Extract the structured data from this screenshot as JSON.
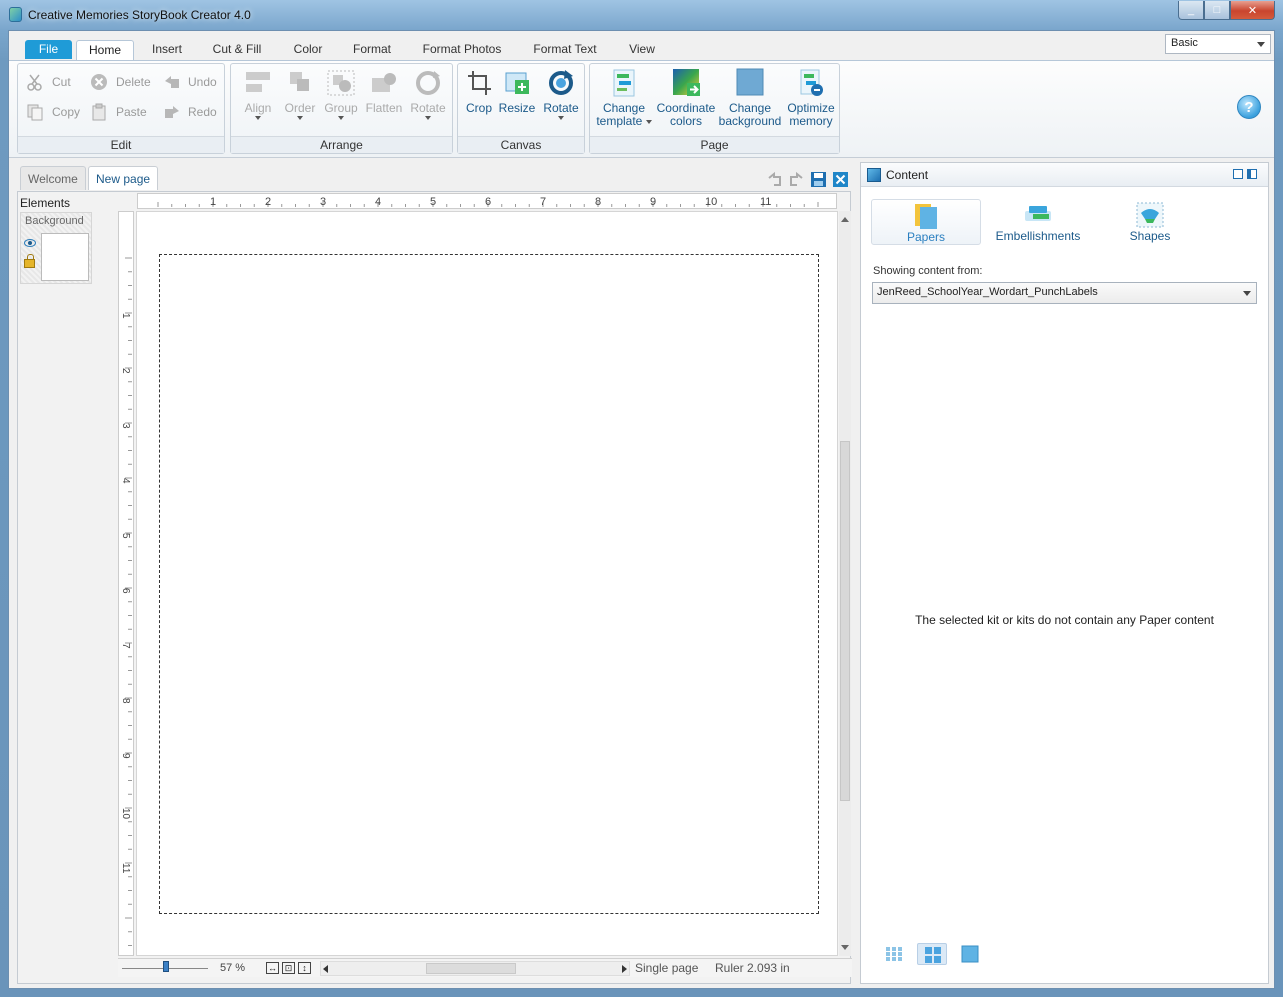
{
  "window": {
    "title": "Creative Memories StoryBook Creator 4.0",
    "min": "_",
    "max": "□",
    "close": "✕"
  },
  "ribbon_tabs": [
    {
      "label": "File"
    },
    {
      "label": "Home"
    },
    {
      "label": "Insert"
    },
    {
      "label": "Cut & Fill"
    },
    {
      "label": "Color"
    },
    {
      "label": "Format"
    },
    {
      "label": "Format Photos"
    },
    {
      "label": "Format Text"
    },
    {
      "label": "View"
    }
  ],
  "mode": {
    "selected": "Basic"
  },
  "help": {
    "label": "?"
  },
  "groups": {
    "edit": {
      "label": "Edit",
      "cut": "Cut",
      "copy": "Copy",
      "delete": "Delete",
      "paste": "Paste",
      "undo": "Undo",
      "redo": "Redo"
    },
    "arrange": {
      "label": "Arrange",
      "align": "Align",
      "order": "Order",
      "group": "Group",
      "flatten": "Flatten",
      "rotate": "Rotate"
    },
    "canvas": {
      "label": "Canvas",
      "crop": "Crop",
      "resize": "Resize",
      "rotate": "Rotate"
    },
    "page": {
      "label": "Page",
      "change_template": [
        "Change",
        "template"
      ],
      "coordinate_colors": [
        "Coordinate",
        "colors"
      ],
      "change_background": [
        "Change",
        "background"
      ],
      "optimize_memory": [
        "Optimize",
        "memory"
      ]
    }
  },
  "doc_tabs": [
    {
      "label": "Welcome"
    },
    {
      "label": "New page"
    }
  ],
  "elements": {
    "label": "Elements",
    "background_label": "Background"
  },
  "ruler": {
    "h_ticks": [
      "1",
      "2",
      "3",
      "4",
      "5",
      "6",
      "7",
      "8",
      "9",
      "10",
      "11"
    ],
    "v_ticks": [
      "1",
      "2",
      "3",
      "4",
      "5",
      "6",
      "7",
      "8",
      "9",
      "10",
      "11"
    ]
  },
  "status": {
    "zoom": "57 %",
    "page_mode": "Single page",
    "ruler_readout": "Ruler 2.093 in"
  },
  "content_panel": {
    "title": "Content",
    "categories": [
      {
        "label": "Papers"
      },
      {
        "label": "Embellishments"
      },
      {
        "label": "Shapes"
      }
    ],
    "showing_label": "Showing content from:",
    "kit": "JenReed_SchoolYear_Wordart_PunchLabels",
    "empty_message": "The selected kit or kits do not contain any Paper content"
  },
  "colors": {
    "accent": "#1f9bd7",
    "link_blue": "#1c5a8a",
    "title_bar": "#7aa6cc"
  }
}
